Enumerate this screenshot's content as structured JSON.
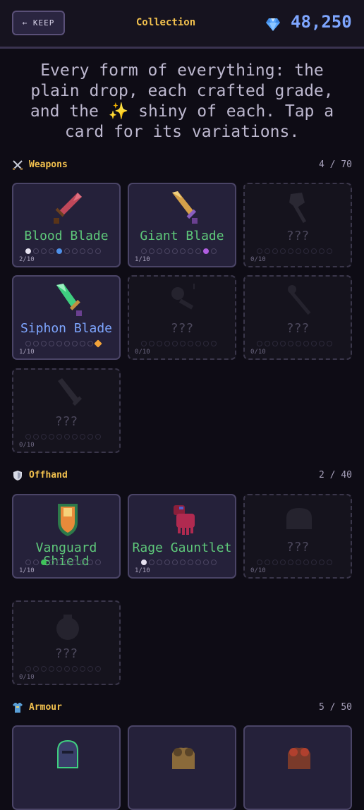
{
  "header": {
    "back_label": "← KEEP",
    "title": "Collection",
    "gems": "48,250"
  },
  "intro": "Every form of everything: the plain drop, each crafted grade, and the ✨ shiny of each. Tap a card for its variations.",
  "sections": [
    {
      "label": "Weapons",
      "count": "4 / 70",
      "icon": "crossed-swords-icon",
      "cards": [
        {
          "name": "Blood Blade",
          "owned": true,
          "progress": "2/10",
          "color": "#5ec87a",
          "dots": [
            "white",
            "empty",
            "empty",
            "empty",
            "blue",
            "empty",
            "empty",
            "empty",
            "empty",
            "empty"
          ]
        },
        {
          "name": "Giant Blade",
          "owned": true,
          "progress": "1/10",
          "color": "#5ec87a",
          "dots": [
            "empty",
            "empty",
            "empty",
            "empty",
            "empty",
            "empty",
            "empty",
            "empty",
            "purple",
            "empty"
          ]
        },
        {
          "name": "???",
          "owned": false,
          "progress": "0/10"
        },
        {
          "name": "Siphon Blade",
          "owned": true,
          "progress": "1/10",
          "color": "#7ea6ff",
          "dots": [
            "empty",
            "empty",
            "empty",
            "empty",
            "empty",
            "empty",
            "empty",
            "empty",
            "empty",
            "orange"
          ]
        },
        {
          "name": "???",
          "owned": false,
          "progress": "0/10"
        },
        {
          "name": "???",
          "owned": false,
          "progress": "0/10"
        },
        {
          "name": "???",
          "owned": false,
          "progress": "0/10"
        }
      ]
    },
    {
      "label": "Offhand",
      "count": "2 / 40",
      "icon": "shield-icon",
      "cards": [
        {
          "name": "Vanguard Shield",
          "owned": true,
          "progress": "1/10",
          "color": "#5ec87a",
          "dots": [
            "empty",
            "empty",
            "green",
            "empty",
            "empty",
            "empty",
            "empty",
            "empty",
            "empty",
            "empty"
          ]
        },
        {
          "name": "Rage Gauntlet",
          "owned": true,
          "progress": "1/10",
          "color": "#5ec87a",
          "dots": [
            "white",
            "empty",
            "empty",
            "empty",
            "empty",
            "empty",
            "empty",
            "empty",
            "empty",
            "empty"
          ]
        },
        {
          "name": "???",
          "owned": false,
          "progress": "0/10"
        },
        {
          "name": "???",
          "owned": false,
          "progress": "0/10"
        }
      ]
    },
    {
      "label": "Armour",
      "count": "5 / 50",
      "icon": "tunic-icon",
      "cards": []
    }
  ]
}
